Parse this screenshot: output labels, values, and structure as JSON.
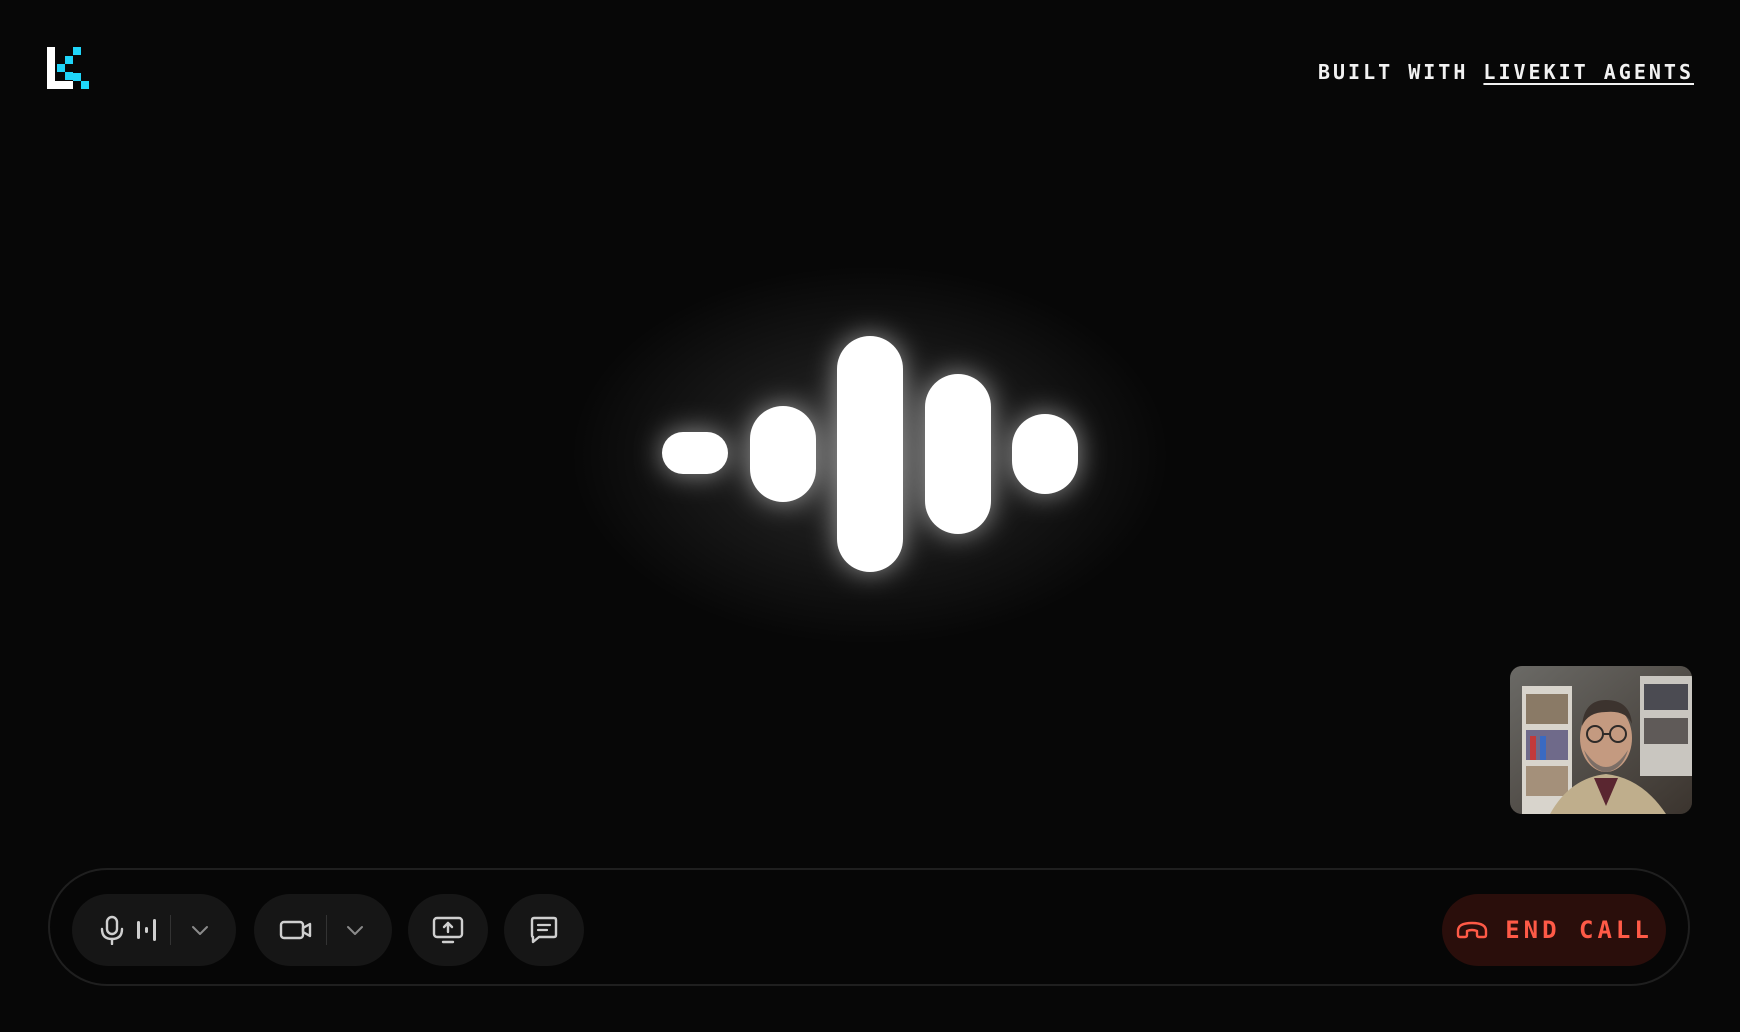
{
  "header": {
    "built_with_prefix": "BUILT WITH ",
    "built_with_link": "LIVEKIT AGENTS"
  },
  "visualizer": {
    "bar_color": "#ffffff",
    "bar_count": 5
  },
  "self_view": {
    "label": "camera preview"
  },
  "controls": {
    "microphone_icon": "microphone-icon",
    "audio_level_icon": "audio-level-icon",
    "camera_icon": "camera-icon",
    "screen_share_icon": "screen-share-icon",
    "chat_icon": "chat-icon",
    "end_call_label": "END CALL",
    "end_call_color": "#ff5a47"
  },
  "colors": {
    "background": "#070707",
    "accent_cyan": "#1fd5f9"
  }
}
